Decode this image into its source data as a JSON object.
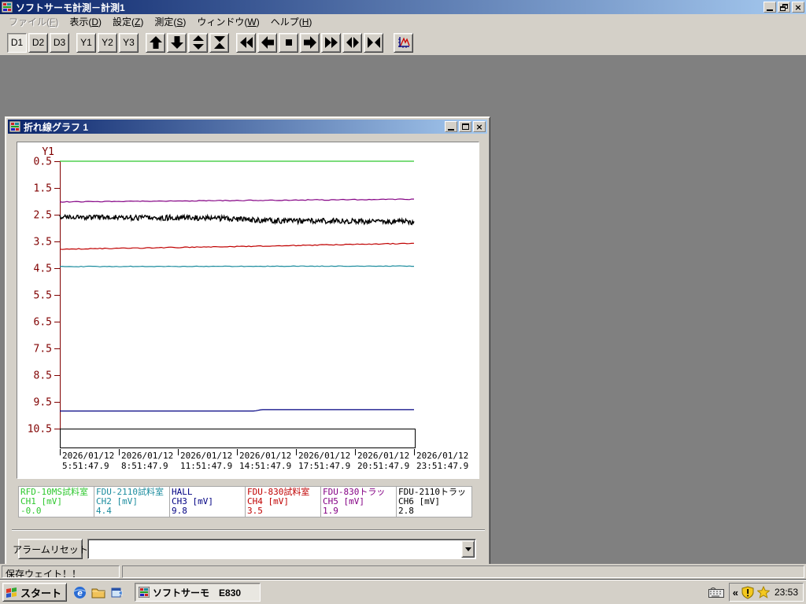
{
  "window": {
    "title": "ソフトサーモ計測－計測1"
  },
  "menu": {
    "items": [
      {
        "label": "ファイル(F)",
        "disabled": true
      },
      {
        "label": "表示(D)",
        "disabled": false
      },
      {
        "label": "設定(Z)",
        "disabled": false
      },
      {
        "label": "測定(S)",
        "disabled": false
      },
      {
        "label": "ウィンドウ(W)",
        "disabled": false
      },
      {
        "label": "ヘルプ(H)",
        "disabled": false
      }
    ]
  },
  "toolbar": {
    "d_buttons": [
      {
        "label": "D1",
        "active": true
      },
      {
        "label": "D2",
        "active": false
      },
      {
        "label": "D3",
        "active": false
      }
    ],
    "y_buttons": [
      {
        "label": "Y1",
        "active": false
      },
      {
        "label": "Y2",
        "active": false
      },
      {
        "label": "Y3",
        "active": false
      }
    ]
  },
  "icons": {
    "app_icon": "colored-grid-chart",
    "start_flag": "windows-flag",
    "quick_launch": [
      "internet-explorer",
      "folder",
      "outlook-window"
    ],
    "tray": [
      "keyboard",
      "security-shield-alert",
      "star"
    ]
  },
  "child_window": {
    "title": "折れ線グラフ 1"
  },
  "chart_data": {
    "type": "line",
    "title": "折れ線グラフ 1",
    "ylabel": "Y1",
    "y_inverted": true,
    "y_ticks": [
      0.5,
      1.5,
      2.5,
      3.5,
      4.5,
      5.5,
      6.5,
      7.5,
      8.5,
      9.5,
      10.5
    ],
    "x_tick_dates": [
      "2026/01/12",
      "2026/01/12",
      "2026/01/12",
      "2026/01/12",
      "2026/01/12",
      "2026/01/12",
      "2026/01/12"
    ],
    "x_tick_times": [
      "5:51:47.9",
      "8:51:47.9",
      "11:51:47.9",
      "14:51:47.9",
      "17:51:47.9",
      "20:51:47.9",
      "23:51:47.9"
    ],
    "series": [
      {
        "name": "RFD-10MS試料室",
        "channel": "CH1 [mV]",
        "current_value": "-0.0",
        "color": "#2ec82e",
        "noise": 0,
        "points": [
          [
            0,
            0.5
          ],
          [
            1,
            0.5
          ]
        ]
      },
      {
        "name": "FDU-2110試料室",
        "channel": "CH2 [mV]",
        "current_value": "4.4",
        "color": "#1b8c9e",
        "noise": 0.012,
        "points": [
          [
            0,
            4.44
          ],
          [
            0.5,
            4.43
          ],
          [
            1,
            4.42
          ]
        ]
      },
      {
        "name": "HALL",
        "channel": "CH3 [mV]",
        "current_value": "9.8",
        "color": "#000082",
        "noise": 0,
        "points": [
          [
            0,
            9.84
          ],
          [
            0.55,
            9.84
          ],
          [
            0.57,
            9.79
          ],
          [
            1,
            9.79
          ]
        ]
      },
      {
        "name": "FDU-830試料室",
        "channel": "CH4 [mV]",
        "current_value": "3.5",
        "color": "#c00000",
        "noise": 0.015,
        "points": [
          [
            0,
            3.79
          ],
          [
            0.5,
            3.69
          ],
          [
            1,
            3.57
          ]
        ]
      },
      {
        "name": "FDU-830トラッ",
        "channel": "CH5 [mV]",
        "current_value": "1.9",
        "color": "#840084",
        "noise": 0.015,
        "points": [
          [
            0,
            2.02
          ],
          [
            0.5,
            1.97
          ],
          [
            1,
            1.92
          ]
        ]
      },
      {
        "name": "FDU-2110トラッ",
        "channel": "CH6 [mV]",
        "current_value": "2.8",
        "color": "#000000",
        "noise": 0.1,
        "points": [
          [
            0,
            2.6
          ],
          [
            0.4,
            2.62
          ],
          [
            0.5,
            2.66
          ],
          [
            0.6,
            2.72
          ],
          [
            1,
            2.77
          ]
        ]
      }
    ],
    "annotation_box": {
      "y_from": 10.5,
      "y_to": 11.2
    },
    "axis_color": "#800000"
  },
  "alarm": {
    "reset_label": "アラームリセット",
    "combo_value": ""
  },
  "status_bar": {
    "message": "保存ウェイト！！"
  },
  "taskbar": {
    "start_label": "スタート",
    "task_button": "ソフトサーモ　E830",
    "tray_chevron": "«",
    "clock": "23:53"
  }
}
